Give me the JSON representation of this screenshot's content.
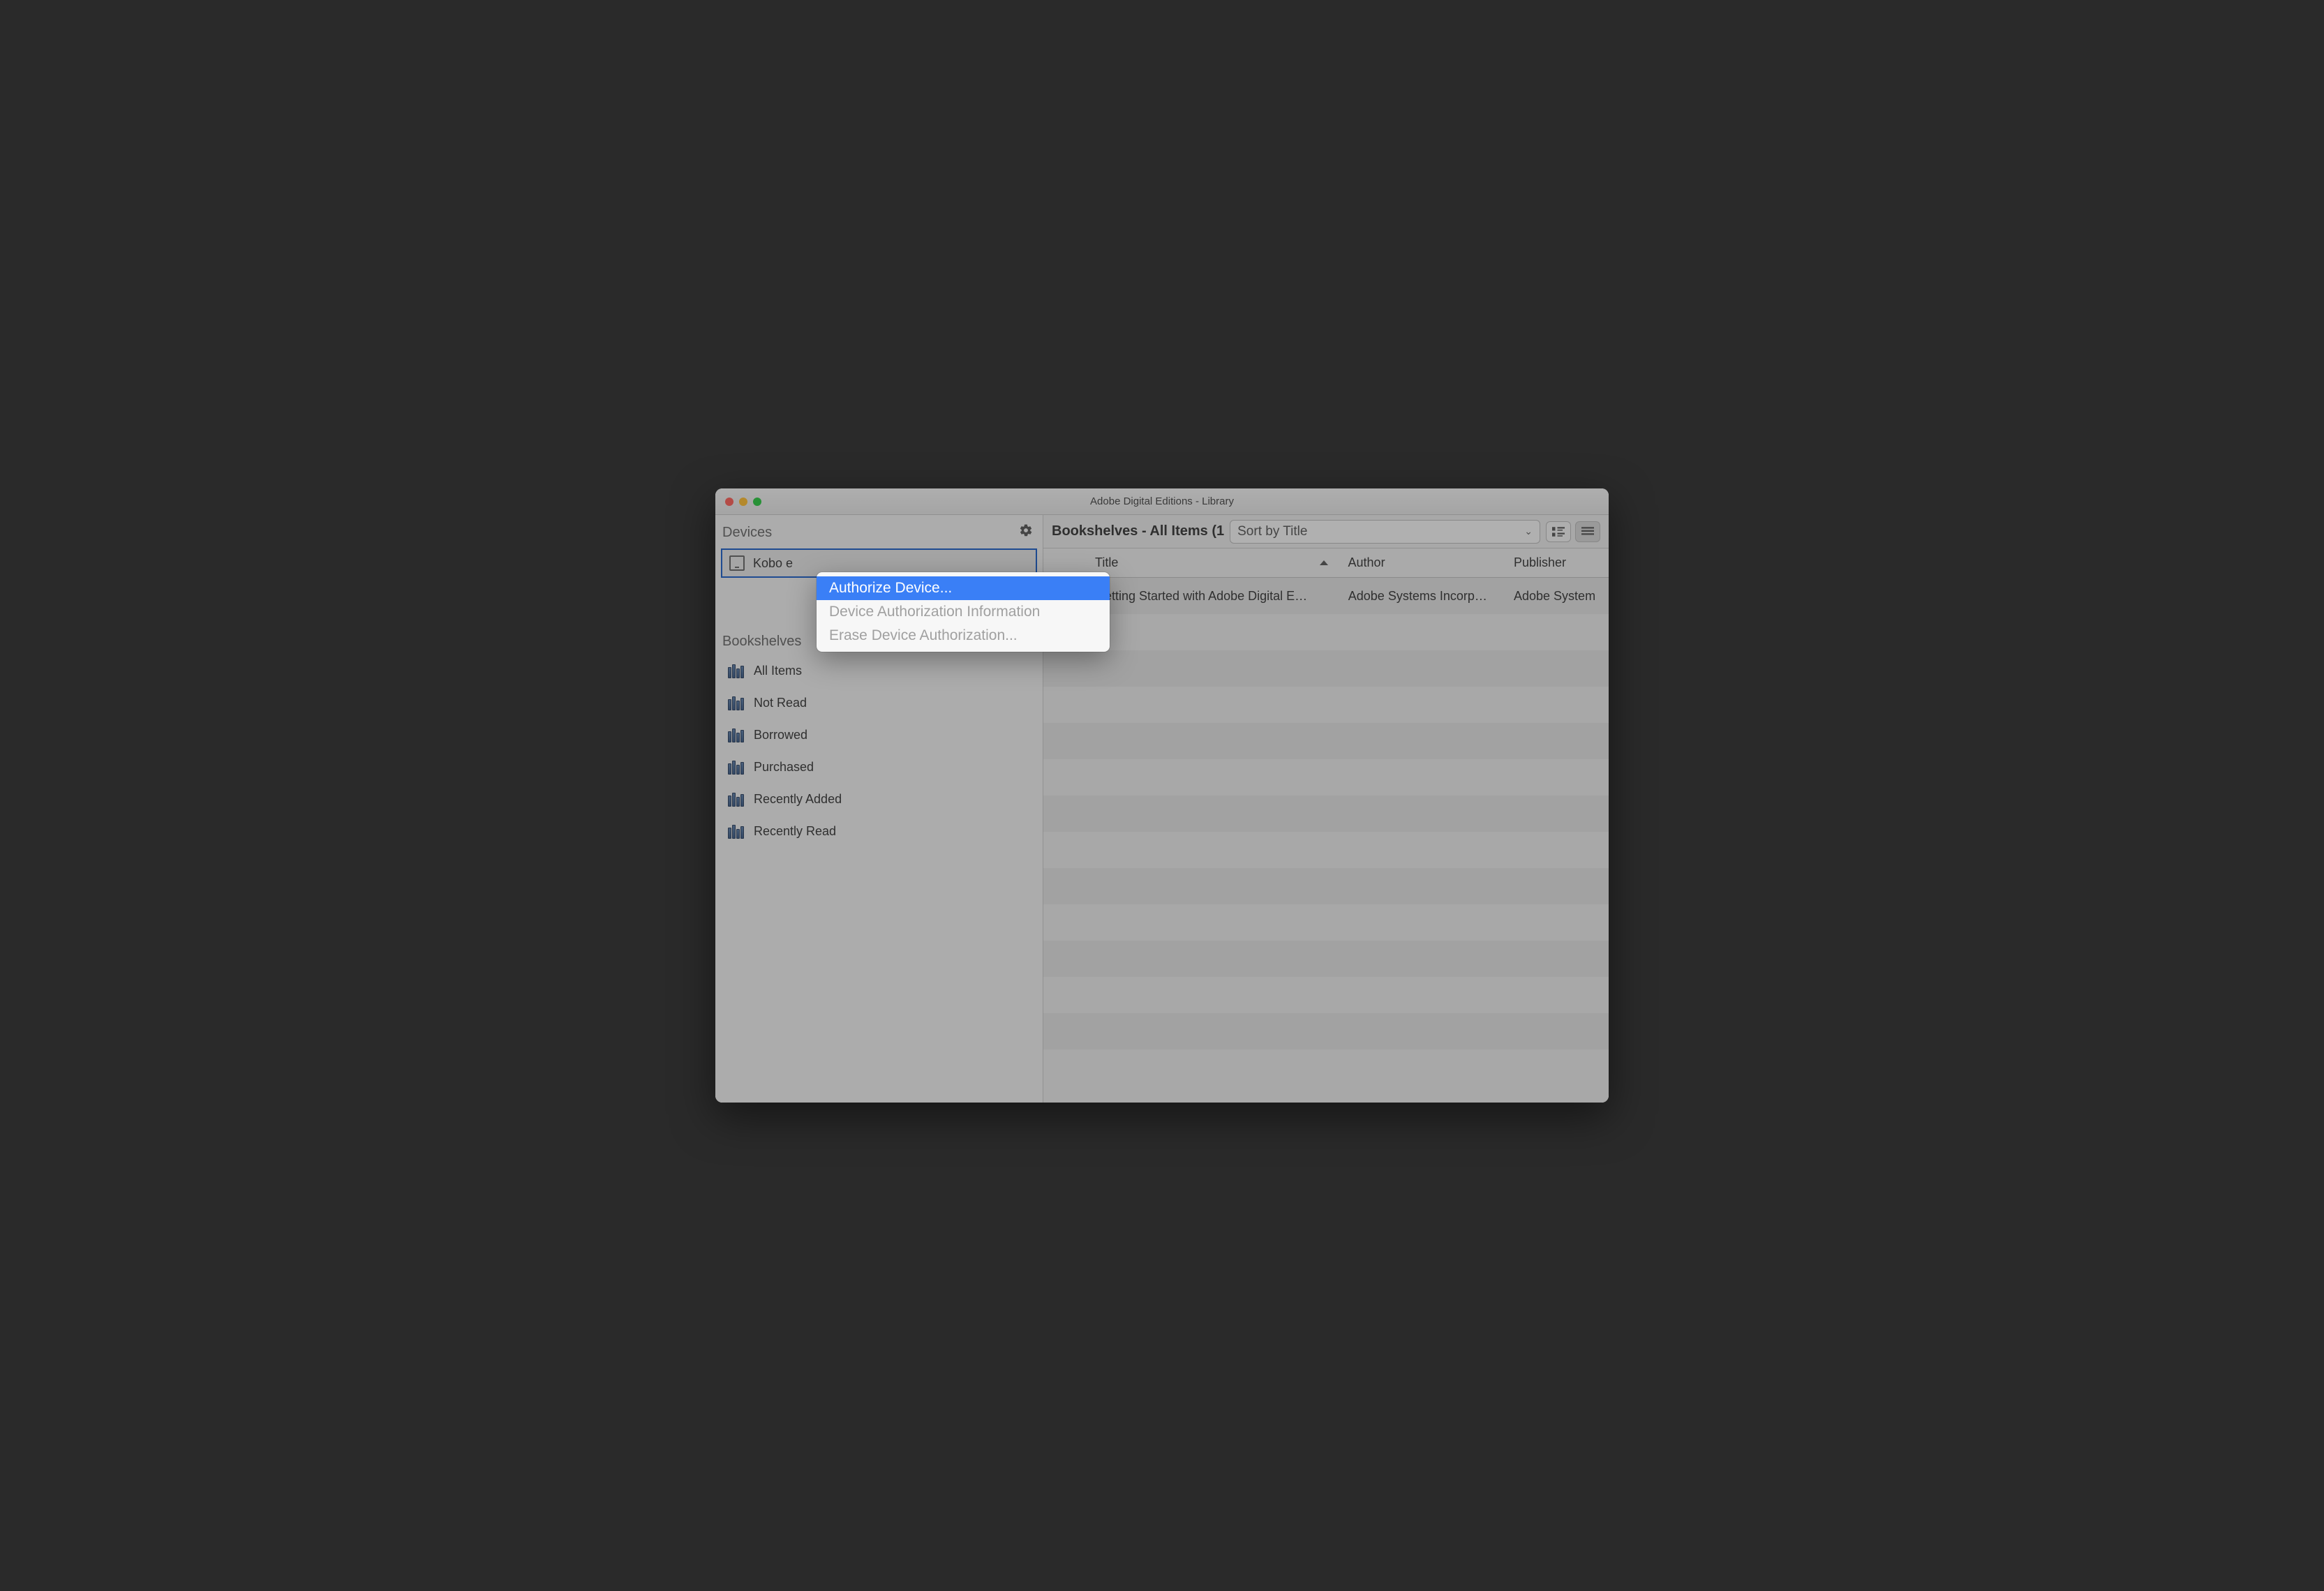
{
  "window": {
    "title": "Adobe Digital Editions - Library"
  },
  "sidebar": {
    "devices_header": "Devices",
    "device_name": "Kobo e",
    "bookshelves_header": "Bookshelves",
    "shelves": [
      {
        "label": "All Items"
      },
      {
        "label": "Not Read"
      },
      {
        "label": "Borrowed"
      },
      {
        "label": "Purchased"
      },
      {
        "label": "Recently Added"
      },
      {
        "label": "Recently Read"
      }
    ]
  },
  "main": {
    "heading": "Bookshelves - All Items (1",
    "sort_label": "Sort by Title",
    "columns": {
      "title": "Title",
      "author": "Author",
      "publisher": "Publisher"
    },
    "rows": [
      {
        "title": "Getting Started with Adobe Digital E…",
        "author": "Adobe Systems Incorp…",
        "publisher": "Adobe System"
      }
    ],
    "blank_row_count": 13
  },
  "context_menu": {
    "items": [
      {
        "label": "Authorize Device...",
        "state": "highlighted"
      },
      {
        "label": "Device Authorization Information",
        "state": "disabled"
      },
      {
        "label": "Erase Device Authorization...",
        "state": "disabled"
      }
    ]
  }
}
